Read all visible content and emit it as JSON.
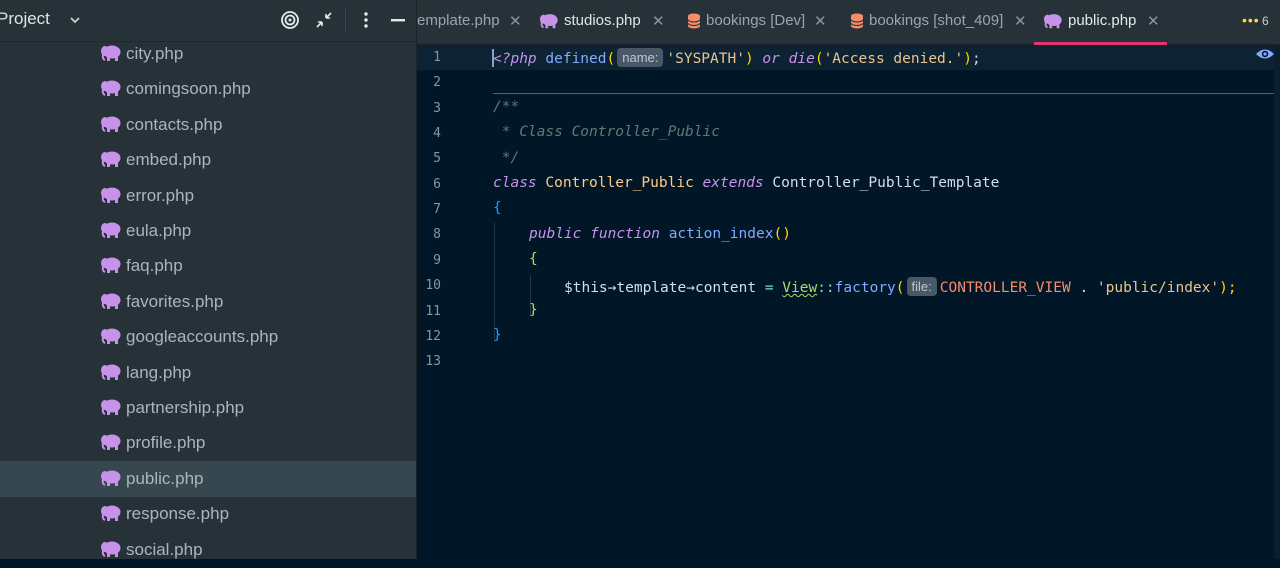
{
  "project_panel": {
    "title": "Project",
    "files": [
      "city.php",
      "comingsoon.php",
      "contacts.php",
      "embed.php",
      "error.php",
      "eula.php",
      "faq.php",
      "favorites.php",
      "googleaccounts.php",
      "lang.php",
      "partnership.php",
      "profile.php",
      "public.php",
      "response.php",
      "social.php"
    ],
    "selected_file": "public.php"
  },
  "tabs": {
    "items": [
      {
        "label": "emplate.php",
        "icon": "php-elephant-icon"
      },
      {
        "label": "studios.php",
        "icon": "php-elephant-icon"
      },
      {
        "label": "bookings [Dev]",
        "icon": "database-icon"
      },
      {
        "label": "bookings [shot_409]",
        "icon": "database-icon"
      },
      {
        "label": "public.php",
        "icon": "php-elephant-icon"
      }
    ],
    "active": "public.php",
    "overflow_count": "6",
    "close_glyph": "✕"
  },
  "editor": {
    "line_numbers": [
      "1",
      "2",
      "3",
      "4",
      "5",
      "6",
      "7",
      "8",
      "9",
      "10",
      "11",
      "12",
      "13"
    ],
    "code": {
      "l1_open": "<?php",
      "l1_defined": "defined",
      "l1_hint": "name:",
      "l1_arg": "'SYSPATH'",
      "l1_or": "or",
      "l1_die": "die",
      "l1_msg": "'Access denied.'",
      "l1_end": ";",
      "l3": "/**",
      "l4": " * Class Controller_Public",
      "l5": " */",
      "l6_class": "class",
      "l6_name": "Controller_Public",
      "l6_extends": "extends",
      "l6_parent": "Controller_Public_Template",
      "l7": "{",
      "l8_public": "public",
      "l8_function": "function",
      "l8_name": "action_index",
      "l8_parens": "()",
      "l9": "{",
      "l10_this": "$this",
      "l10_arrow1": "→",
      "l10_template": "template",
      "l10_arrow2": "→",
      "l10_content": "content",
      "l10_eq": "=",
      "l10_view": "View",
      "l10_colons": "::",
      "l10_factory": "factory",
      "l10_hint": "file:",
      "l10_const": "CONTROLLER_VIEW",
      "l10_dot": ".",
      "l10_str": "'public/index'",
      "l10_end": ");",
      "l11": "}",
      "l12": "}"
    }
  },
  "colors": {
    "accent": "#e5336b",
    "editor_bg": "#011627",
    "panel_bg": "#263238",
    "php_icon": "#c792ea",
    "db_icon": "#f78c6c"
  }
}
